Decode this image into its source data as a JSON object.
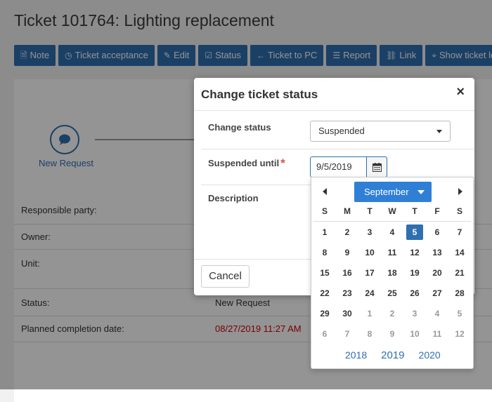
{
  "page": {
    "title": "Ticket 101764: Lighting replacement"
  },
  "toolbar": [
    {
      "label": "Note",
      "icon": "note-icon",
      "glyph": "🗎"
    },
    {
      "label": "Ticket acceptance",
      "icon": "clock-icon",
      "glyph": "◷"
    },
    {
      "label": "Edit",
      "icon": "pencil-icon",
      "glyph": "✎"
    },
    {
      "label": "Status",
      "icon": "checkbox-icon",
      "glyph": "☑"
    },
    {
      "label": "Ticket to PC",
      "icon": "arrow-left-icon",
      "glyph": "←"
    },
    {
      "label": "Report",
      "icon": "list-icon",
      "glyph": "☰"
    },
    {
      "label": "Link",
      "icon": "link-icon",
      "glyph": "⛓"
    },
    {
      "label": "Show ticket loca",
      "icon": "map-marker-icon",
      "glyph": "⌖"
    }
  ],
  "progress": {
    "step_label": "New Request"
  },
  "details": {
    "responsible_label": "Responsible party:",
    "owner_label": "Owner:",
    "unit_label": "Unit:",
    "status_label": "Status:",
    "status_value": "New Request",
    "planned_label": "Planned completion date:",
    "planned_value": "08/27/2019 11:27 AM",
    "planned_color": "#cc0000"
  },
  "modal": {
    "title": "Change ticket status",
    "close_glyph": "×",
    "change_status_label": "Change status",
    "status_value": "Suspended",
    "suspended_until_label": "Suspended until",
    "required_mark": "*",
    "date_value": "9/5/2019",
    "description_label": "Description",
    "cancel_label": "Cancel"
  },
  "datepicker": {
    "month": "September",
    "weekdays": [
      "S",
      "M",
      "T",
      "W",
      "T",
      "F",
      "S"
    ],
    "weeks": [
      [
        "1",
        "2",
        "3",
        "4",
        "5",
        "6",
        "7"
      ],
      [
        "8",
        "9",
        "10",
        "11",
        "12",
        "13",
        "14"
      ],
      [
        "15",
        "16",
        "17",
        "18",
        "19",
        "20",
        "21"
      ],
      [
        "22",
        "23",
        "24",
        "25",
        "26",
        "27",
        "28"
      ],
      [
        "29",
        "30",
        "1",
        "2",
        "3",
        "4",
        "5"
      ],
      [
        "6",
        "7",
        "8",
        "9",
        "10",
        "11",
        "12"
      ]
    ],
    "selected_day": "5",
    "years": [
      "2018",
      "2019",
      "2020"
    ],
    "current_year": "2019",
    "accent": "#2f6fb0"
  }
}
